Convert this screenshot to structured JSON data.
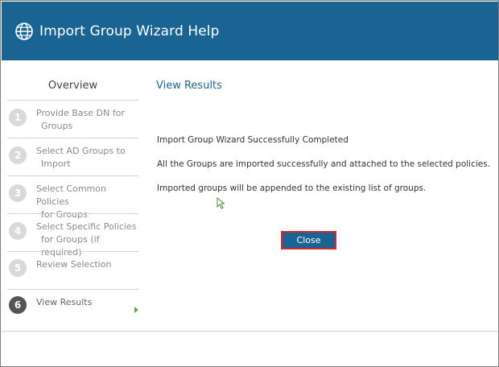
{
  "header": {
    "title": "Import Group Wizard Help",
    "icon": "globe-icon",
    "bg_color": "#1a6493"
  },
  "sidebar": {
    "overview": "Overview",
    "steps": [
      {
        "num": "1",
        "line1": "Provide Base DN for",
        "line2": "Groups",
        "active": false
      },
      {
        "num": "2",
        "line1": "Select AD Groups to",
        "line2": "Import",
        "active": false
      },
      {
        "num": "3",
        "line1": "Select Common Policies",
        "line2": "for Groups",
        "active": false
      },
      {
        "num": "4",
        "line1": "Select Specific Policies",
        "line2": "for Groups (if required)",
        "active": false
      },
      {
        "num": "5",
        "line1": "Review Selection",
        "line2": "",
        "active": false
      },
      {
        "num": "6",
        "line1": "View Results",
        "line2": "",
        "active": true
      }
    ]
  },
  "main": {
    "title": "View Results",
    "messages": [
      "Import Group Wizard Successfully Completed",
      "All the Groups are imported successfully and attached to the selected policies.",
      "Imported groups will be appended to the existing list of groups."
    ],
    "close_label": "Close"
  },
  "colors": {
    "accent": "#1a6493",
    "highlight_border": "#d22a2a",
    "active_arrow": "#6aa84f"
  }
}
